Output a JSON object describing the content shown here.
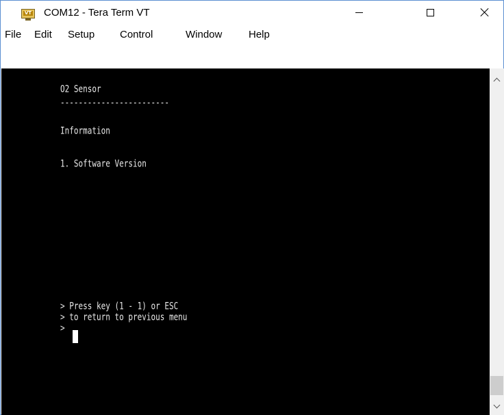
{
  "window": {
    "title": "COM12 - Tera Term VT",
    "icon": "tera-term-vt-icon",
    "icon_label": "VT"
  },
  "menu": {
    "items": [
      "File",
      "Edit",
      "Setup",
      "Control",
      "Window",
      "Help"
    ]
  },
  "terminal": {
    "lines": [
      "O2 Sensor",
      "------------------------",
      "Information",
      "1. Software Version",
      "> Press key (1 - 1) or ESC",
      "> to return to previous menu",
      "> "
    ],
    "background": "#000000",
    "foreground": "#e8e8e8"
  },
  "scrollbar": {
    "up_icon": "chevron-up-icon",
    "down_icon": "chevron-down-icon"
  }
}
